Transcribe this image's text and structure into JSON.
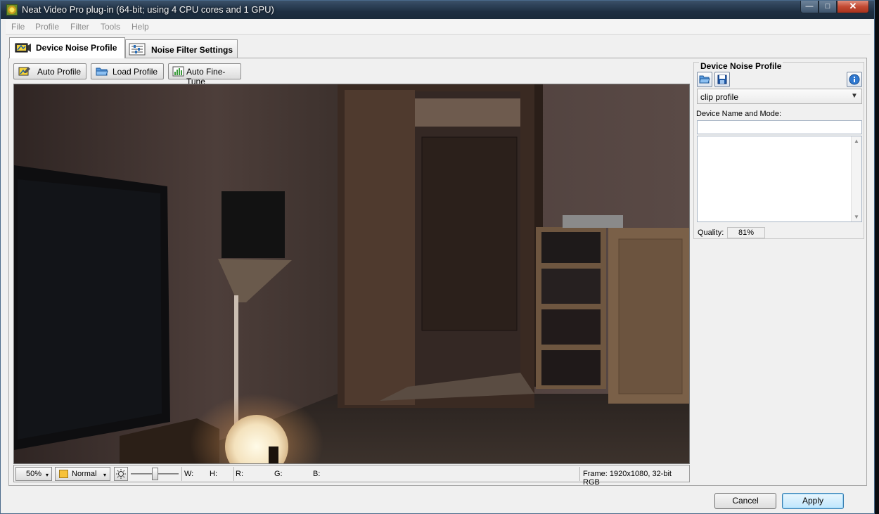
{
  "window": {
    "title": "Neat Video Pro plug-in (64-bit; using 4 CPU cores and 1 GPU)",
    "min_glyph": "—",
    "max_glyph": "□",
    "close_glyph": "✕"
  },
  "menu": [
    "File",
    "Profile",
    "Filter",
    "Tools",
    "Help"
  ],
  "tabs": [
    {
      "label": "Device Noise Profile",
      "active": true,
      "icon": "camera-profile-icon"
    },
    {
      "label": "Noise Filter Settings",
      "active": false,
      "icon": "sliders-icon"
    }
  ],
  "toolbar": {
    "auto_profile": "Auto Profile",
    "load_profile": "Load Profile",
    "auto_fine_tune": "Auto Fine-Tune"
  },
  "statusbar": {
    "zoom": "50%",
    "mode": "Normal",
    "w_label": "W:",
    "h_label": "H:",
    "r_label": "R:",
    "g_label": "G:",
    "b_label": "B:",
    "frame_info": "Frame: 1920x1080, 32-bit RGB"
  },
  "profile_panel": {
    "title": "Device Noise Profile",
    "profile_select": "clip profile",
    "device_label": "Device Name and Mode:",
    "device_value": "",
    "notes_value": "",
    "quality_label": "Quality:",
    "quality_value": "81%"
  },
  "buttons": {
    "cancel": "Cancel",
    "apply": "Apply"
  },
  "colors": {
    "accent": "#3c7fb1",
    "titlebar": "#1e2f42",
    "close": "#c24a33"
  }
}
